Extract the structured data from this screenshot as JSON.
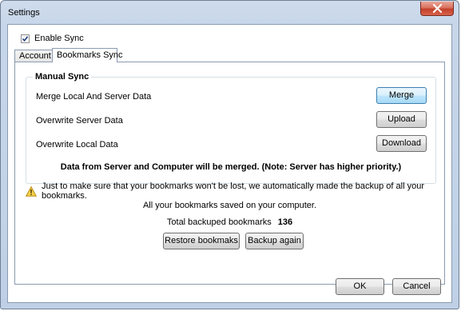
{
  "window": {
    "title": "Settings"
  },
  "enable_sync": {
    "label": "Enable Sync",
    "checked": true
  },
  "tabs": [
    {
      "label": "Account",
      "active": false
    },
    {
      "label": "Bookmarks Sync",
      "active": true
    }
  ],
  "manual_sync": {
    "legend": "Manual Sync",
    "rows": [
      {
        "label": "Merge Local And Server Data",
        "button": "Merge"
      },
      {
        "label": "Overwrite Server Data",
        "button": "Upload"
      },
      {
        "label": "Overwrite Local Data",
        "button": "Download"
      }
    ],
    "note": "Data from Server and Computer will be merged. (Note: Server has higher priority.)"
  },
  "backup_info": {
    "warning": "Just to make sure that your bookmarks won't be lost, we automatically made the backup of all your bookmarks.",
    "saved_text": "All your bookmarks saved on your computer.",
    "total_label": "Total backuped bookmarks",
    "total_value": "136",
    "restore_button": "Restore bookmaks",
    "backup_button": "Backup again"
  },
  "footer": {
    "ok_label": "OK",
    "cancel_label": "Cancel"
  },
  "colors": {
    "frame": "#c7d6e9",
    "close_button": "#c3402a",
    "default_button_border": "#3c7fb1"
  },
  "icons": {
    "close": "close-icon",
    "checkbox": "checkmark-icon",
    "warning": "warning-icon"
  }
}
